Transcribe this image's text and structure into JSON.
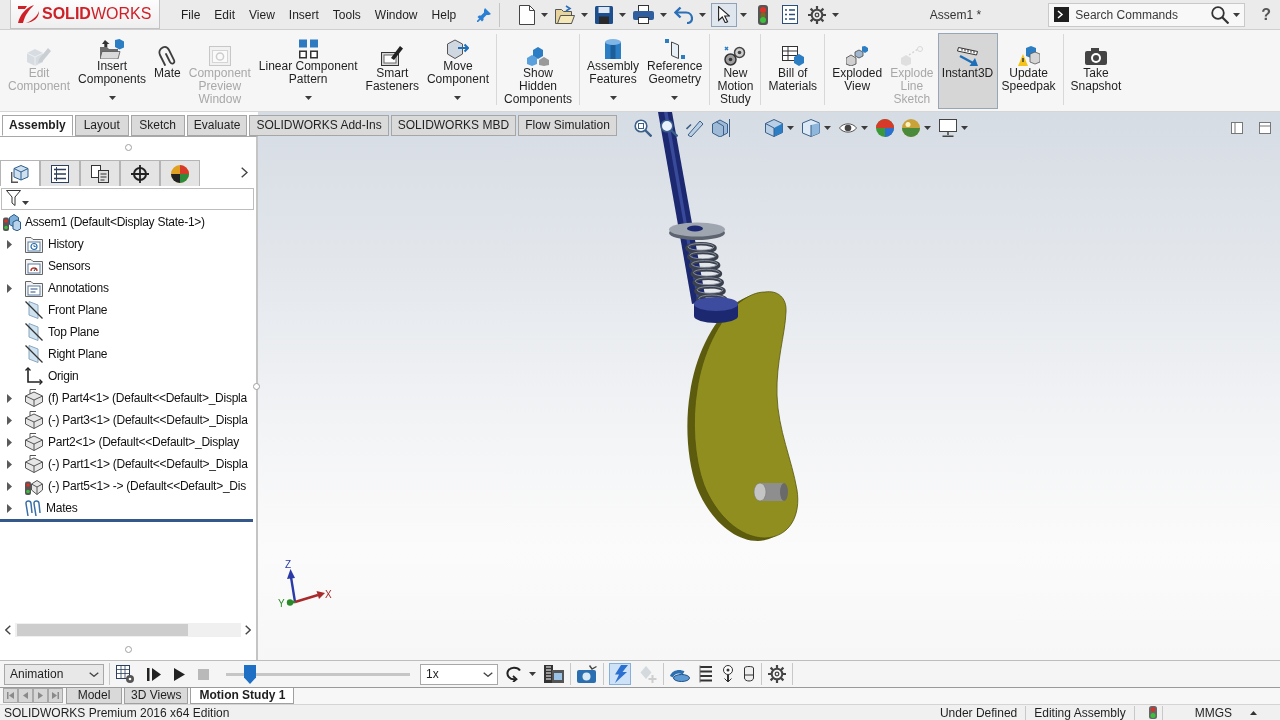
{
  "window": {
    "title": "Assem1 *"
  },
  "logo": {
    "text": "**SOLID**WORKS"
  },
  "menu": [
    "File",
    "Edit",
    "View",
    "Insert",
    "Tools",
    "Window",
    "Help"
  ],
  "search": {
    "placeholder": "Search Commands"
  },
  "help": {
    "label": "?"
  },
  "ribbon": {
    "groups": [
      {
        "buttons": [
          {
            "label": "Edit\nComponent",
            "disabled": true,
            "on": false,
            "dropdown": false
          },
          {
            "label": "Insert\nComponents",
            "disabled": false,
            "on": false,
            "dropdown": true
          },
          {
            "label": "Mate",
            "disabled": false,
            "on": false,
            "dropdown": false
          },
          {
            "label": "Component\nPreview\nWindow",
            "disabled": true,
            "on": false,
            "dropdown": false
          },
          {
            "label": "Linear Component\nPattern",
            "disabled": false,
            "on": false,
            "dropdown": true
          },
          {
            "label": "Smart\nFasteners",
            "disabled": false,
            "on": false,
            "dropdown": false
          },
          {
            "label": "Move\nComponent",
            "disabled": false,
            "on": false,
            "dropdown": true
          }
        ]
      },
      {
        "buttons": [
          {
            "label": "Show\nHidden\nComponents",
            "disabled": false,
            "on": false,
            "dropdown": false
          }
        ]
      },
      {
        "buttons": [
          {
            "label": "Assembly\nFeatures",
            "disabled": false,
            "on": false,
            "dropdown": true
          },
          {
            "label": "Reference\nGeometry",
            "disabled": false,
            "on": false,
            "dropdown": true
          }
        ]
      },
      {
        "buttons": [
          {
            "label": "New\nMotion\nStudy",
            "disabled": false,
            "on": false,
            "dropdown": false
          }
        ]
      },
      {
        "buttons": [
          {
            "label": "Bill of\nMaterials",
            "disabled": false,
            "on": false,
            "dropdown": false
          }
        ]
      },
      {
        "buttons": [
          {
            "label": "Exploded\nView",
            "disabled": false,
            "on": false,
            "dropdown": false
          },
          {
            "label": "Explode\nLine\nSketch",
            "disabled": true,
            "on": false,
            "dropdown": false
          },
          {
            "label": "Instant3D",
            "disabled": false,
            "on": true,
            "dropdown": false
          },
          {
            "label": "Update\nSpeedpak",
            "disabled": false,
            "on": false,
            "dropdown": false
          }
        ]
      },
      {
        "buttons": [
          {
            "label": "Take\nSnapshot",
            "disabled": false,
            "on": false,
            "dropdown": false
          }
        ]
      }
    ]
  },
  "command_tabs": [
    {
      "label": "Assembly",
      "selected": true
    },
    {
      "label": "Layout",
      "selected": false
    },
    {
      "label": "Sketch",
      "selected": false
    },
    {
      "label": "Evaluate",
      "selected": false
    },
    {
      "label": "SOLIDWORKS Add-Ins",
      "selected": false
    },
    {
      "label": "SOLIDWORKS MBD",
      "selected": false
    },
    {
      "label": "Flow Simulation",
      "selected": false
    }
  ],
  "feature_manager": {
    "panel_tabs": [
      {
        "selected": true
      },
      {
        "selected": false
      },
      {
        "selected": false
      },
      {
        "selected": false
      },
      {
        "selected": false
      }
    ],
    "tree": {
      "kind": "assembly",
      "label": "Assem1 (Default<Display State-1>)",
      "expandable": false,
      "children": [
        {
          "kind": "history",
          "label": "History",
          "expandable": true
        },
        {
          "kind": "sensors",
          "label": "Sensors",
          "expandable": false
        },
        {
          "kind": "annotations",
          "label": "Annotations",
          "expandable": true
        },
        {
          "kind": "plane",
          "label": "Front Plane",
          "expandable": false
        },
        {
          "kind": "plane",
          "label": "Top Plane",
          "expandable": false
        },
        {
          "kind": "plane",
          "label": "Right Plane",
          "expandable": false
        },
        {
          "kind": "origin",
          "label": "Origin",
          "expandable": false
        },
        {
          "kind": "part",
          "label": "(f) Part4<1> (Default<<Default>_Displa",
          "expandable": true
        },
        {
          "kind": "part",
          "label": "(-) Part3<1> (Default<<Default>_Displa",
          "expandable": true
        },
        {
          "kind": "part",
          "label": "Part2<1> (Default<<Default>_Display",
          "expandable": true
        },
        {
          "kind": "part",
          "label": "(-) Part1<1> (Default<<Default>_Displa",
          "expandable": true
        },
        {
          "kind": "subassembly",
          "label": "(-) Part5<1> -> (Default<<Default>_Dis",
          "expandable": true
        },
        {
          "kind": "mates",
          "label": "Mates",
          "expandable": true
        }
      ]
    }
  },
  "viewport": {
    "axis_labels": [
      "Z",
      "X",
      "Y"
    ]
  },
  "motion_study": {
    "study_type": "Animation",
    "playback": [
      {
        "disabled": false
      },
      {
        "disabled": false
      },
      {
        "disabled": false
      },
      {
        "disabled": true
      }
    ],
    "timeline": {
      "level": 0.13
    },
    "speed": "1x",
    "tool_groups": [
      {
        "tools": [
          {
            "on": false,
            "disabled": false
          },
          {
            "on": false,
            "disabled": false
          }
        ]
      },
      {
        "tools": [
          {
            "on": false,
            "disabled": false
          }
        ]
      },
      {
        "tools": [
          {
            "on": true,
            "disabled": false
          },
          {
            "on": false,
            "disabled": true
          }
        ]
      },
      {
        "tools": [
          {
            "on": false,
            "disabled": false
          },
          {
            "on": false,
            "disabled": false
          },
          {
            "on": false,
            "disabled": false
          },
          {
            "on": false,
            "disabled": false
          }
        ]
      },
      {
        "tools": [
          {
            "on": false,
            "disabled": false
          }
        ]
      }
    ]
  },
  "bottom_tabs": [
    {
      "label": "Model",
      "selected": false
    },
    {
      "label": "3D Views",
      "selected": false
    },
    {
      "label": "Motion Study 1",
      "selected": true
    }
  ],
  "status_bar": {
    "edition": "SOLIDWORKS Premium 2016 x64 Edition",
    "sections": [
      "Under Defined",
      "Editing Assembly"
    ],
    "units": "MMGS"
  }
}
